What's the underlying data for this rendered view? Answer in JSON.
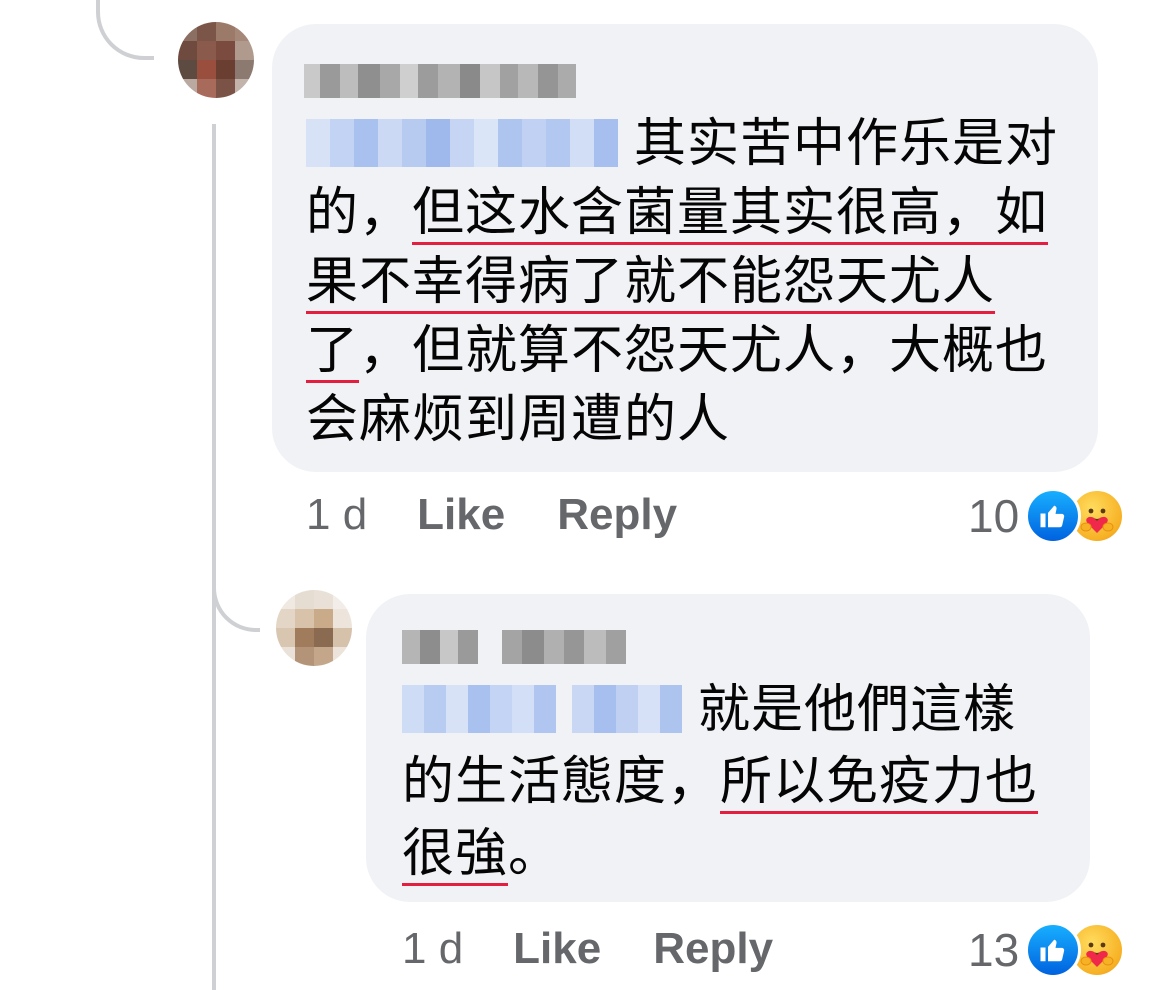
{
  "comments": [
    {
      "author_redacted": true,
      "mention_redacted": true,
      "text_plain": "其实苦中作乐是对的，",
      "text_underlined_1": "但这水含菌量其实很高，如果不幸得病了就不能怨天尤人了",
      "text_after": "，但就算不怨天尤人，大概也会麻烦到周遭的人",
      "time": "1 d",
      "like_label": "Like",
      "reply_label": "Reply",
      "reaction_count": "10",
      "reactions": [
        "like-icon",
        "care-icon"
      ]
    },
    {
      "author_redacted": true,
      "mention_redacted": true,
      "text_plain": "就是他們這樣的生活態度，",
      "text_underlined_1": "所以免疫力也很強",
      "text_after": "。",
      "time": "1 d",
      "like_label": "Like",
      "reply_label": "Reply",
      "reaction_count": "13",
      "reactions": [
        "like-icon",
        "care-icon"
      ]
    }
  ],
  "colors": {
    "bubble_bg": "#f0f2f5",
    "underline": "#e41e3f",
    "meta_text": "#65676b",
    "like_blue": "#0866ff",
    "thread_line": "#ced0d4"
  }
}
